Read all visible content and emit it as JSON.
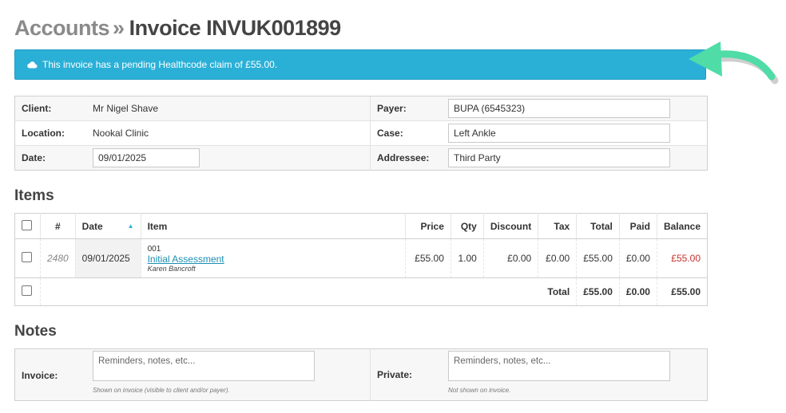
{
  "header": {
    "crumb": "Accounts",
    "separator": "»",
    "title": "Invoice INVUK001899"
  },
  "alert": {
    "text": "This invoice has a pending Healthcode claim of £55.00.",
    "icon": "cloud-icon"
  },
  "info": {
    "client_label": "Client:",
    "client": "Mr Nigel Shave",
    "payer_label": "Payer:",
    "payer": "BUPA (6545323)",
    "location_label": "Location:",
    "location": "Nookal Clinic",
    "case_label": "Case:",
    "case": "Left Ankle",
    "date_label": "Date:",
    "date": "09/01/2025",
    "addressee_label": "Addressee:",
    "addressee": "Third Party"
  },
  "items": {
    "heading": "Items",
    "columns": {
      "hash": "#",
      "date": "Date",
      "item": "Item",
      "price": "Price",
      "qty": "Qty",
      "discount": "Discount",
      "tax": "Tax",
      "total": "Total",
      "paid": "Paid",
      "balance": "Balance"
    },
    "rows": [
      {
        "num": "2480",
        "date": "09/01/2025",
        "code": "001",
        "name": "Initial Assessment",
        "practitioner": "Karen Bancroft",
        "price": "£55.00",
        "qty": "1.00",
        "discount": "£0.00",
        "tax": "£0.00",
        "total": "£55.00",
        "paid": "£0.00",
        "balance": "£55.00"
      }
    ],
    "totals": {
      "label": "Total",
      "total": "£55.00",
      "paid": "£0.00",
      "balance": "£55.00"
    }
  },
  "notes": {
    "heading": "Notes",
    "invoice_label": "Invoice:",
    "invoice_placeholder": "Reminders, notes, etc...",
    "invoice_help": "Shown on invoice (visible to client and/or payer).",
    "private_label": "Private:",
    "private_placeholder": "Reminders, notes, etc...",
    "private_help": "Not shown on invoice."
  },
  "colors": {
    "alert": "#2ab0d7",
    "link": "#1b8fb3",
    "balance_due": "#c9302c",
    "arrow": "#4fdca6"
  }
}
